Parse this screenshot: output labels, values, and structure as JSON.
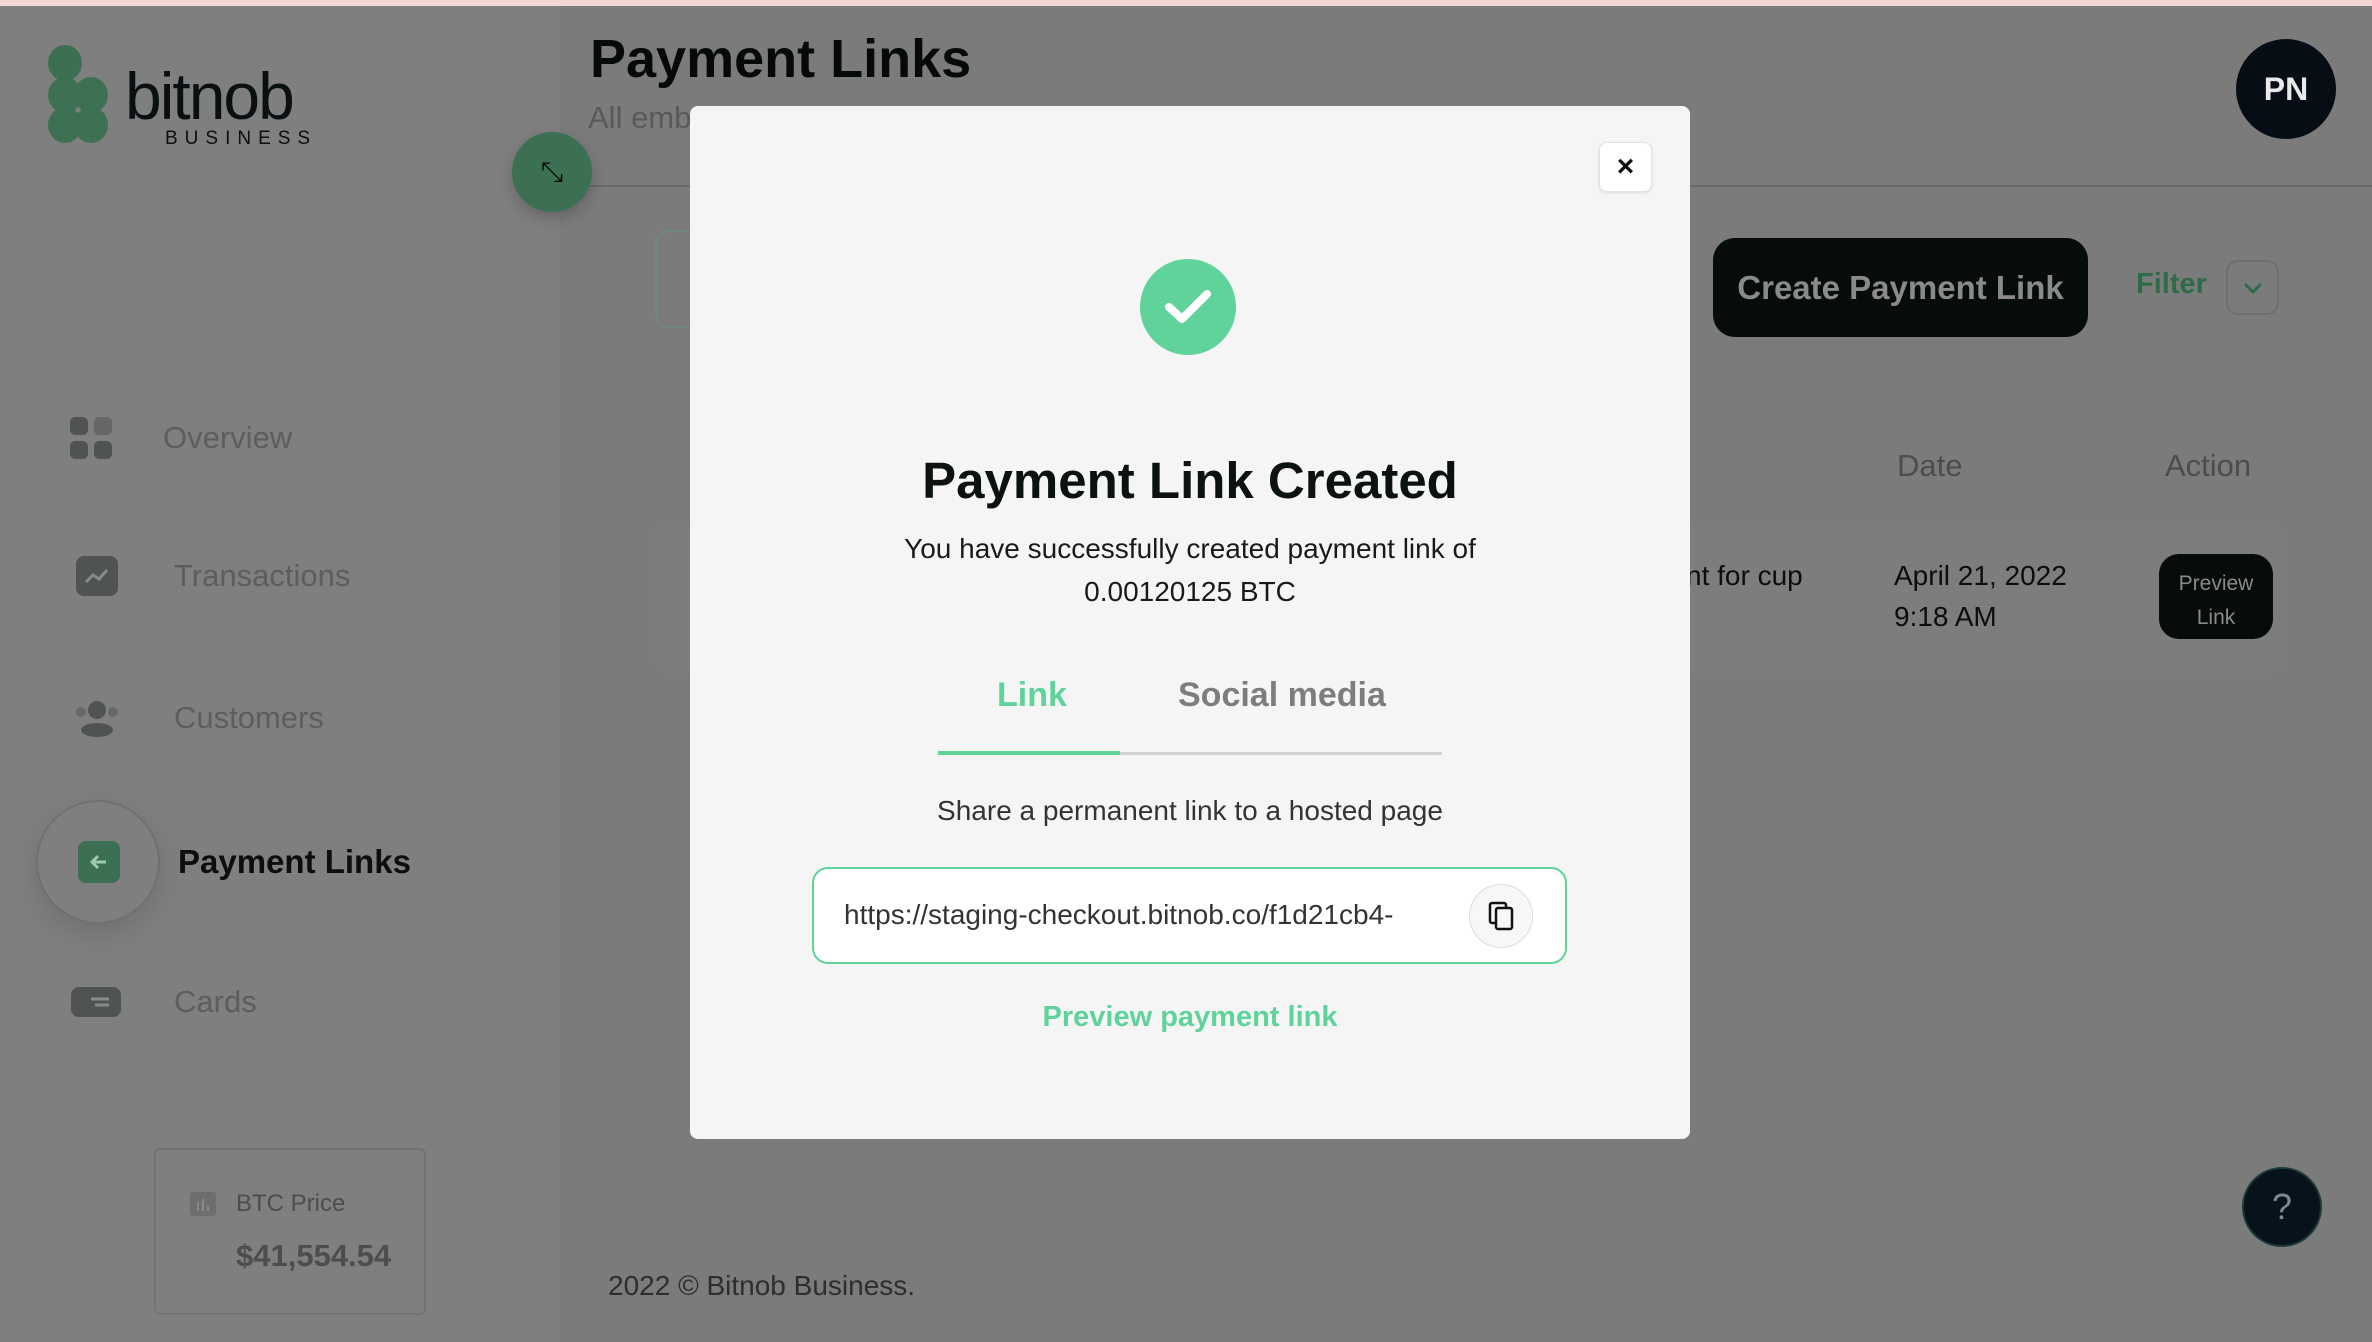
{
  "brand": {
    "name": "bitnob",
    "sub": "BUSINESS",
    "accent": "#5fd39a"
  },
  "sidebar": {
    "items": [
      {
        "label": "Overview",
        "icon": "grid-icon"
      },
      {
        "label": "Transactions",
        "icon": "chart-icon"
      },
      {
        "label": "Customers",
        "icon": "users-icon"
      },
      {
        "label": "Payment Links",
        "icon": "arrow-left-icon",
        "active": true
      },
      {
        "label": "Cards",
        "icon": "card-icon"
      }
    ],
    "btc": {
      "label": "BTC Price",
      "value": "$41,554.54"
    }
  },
  "header": {
    "title": "Payment Links",
    "subtitle": "All emb",
    "avatar": "PN"
  },
  "toolbar": {
    "create": "Create Payment Link",
    "filter": "Filter"
  },
  "table": {
    "headers": [
      "Date",
      "Action"
    ],
    "rows": [
      {
        "description": "nt for cup",
        "date": "April 21, 2022",
        "time": "9:18 AM",
        "action": "Preview Link"
      }
    ]
  },
  "footer": "2022 © Bitnob Business.",
  "help": "?",
  "modal": {
    "close": "×",
    "title": "Payment Link Created",
    "line1": "You have successfully created payment link of",
    "line2": "0.00120125 BTC",
    "tabs": [
      {
        "label": "Link",
        "active": true
      },
      {
        "label": "Social media",
        "active": false
      }
    ],
    "share_text": "Share a permanent link to a hosted page",
    "url": "https://staging-checkout.bitnob.co/f1d21cb4-",
    "preview": "Preview payment link"
  }
}
